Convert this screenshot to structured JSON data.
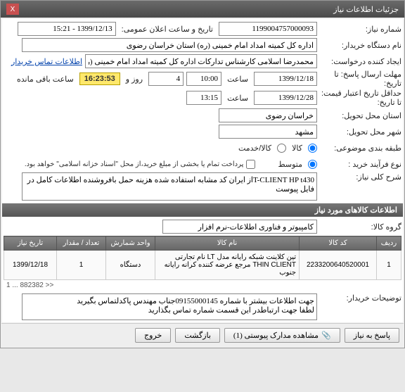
{
  "window": {
    "title": "جزئیات اطلاعات نیاز",
    "close": "X"
  },
  "section1": {
    "header": "",
    "reqno_lbl": "شماره نیاز:",
    "reqno": "1199004757000093",
    "pubdate_lbl": "تاریخ و ساعت اعلان عمومی:",
    "pubdate": "1399/12/13 - 15:21",
    "buyer_lbl": "نام دستگاه خریدار:",
    "buyer": "اداره کل کمیته امداد امام خمینی (ره) استان خراسان رضوی",
    "creator_lbl": "ایجاد کننده درخواست:",
    "creator": "محمدرضا اسلامی کارشناس تدارکات اداره کل کمیته امداد امام خمینی (ره) است",
    "contact_link": "اطلاعات تماس خریدار",
    "deadline_resp_lbl": "مهلت ارسال پاسخ: تا تاریخ:",
    "deadline_date": "1399/12/18",
    "time_lbl": "ساعت",
    "deadline_time": "10:00",
    "days_remain": "4",
    "days_lbl": "روز و",
    "timer": "16:23:53",
    "remain_lbl": "ساعت باقی مانده",
    "price_valid_lbl": "حداقل تاریخ اعتبار قیمت: تا تاریخ:",
    "price_valid_date": "1399/12/28",
    "price_valid_time": "13:15",
    "deliv_prov_lbl": "استان محل تحویل:",
    "deliv_prov": "خراسان رضوی",
    "deliv_city_lbl": "شهر محل تحویل:",
    "deliv_city": "مشهد",
    "group_lbl": "طبقه بندی موضوعی:",
    "group_opt1": "کالا",
    "group_opt2": "کالا/خدمت",
    "process_lbl": "نوع فرآیند خرید :",
    "process_opt1": "متوسط",
    "process_note": "پرداخت تمام یا بخشی از مبلغ خرید،از محل \"اسناد خزانه اسلامی\" خواهد بود.",
    "desc_lbl": "شرح کلی نیاز:",
    "desc": "T-CLIENT HP t430از ایران کد مشابه استفاده شده هزینه حمل بافروشنده اطلاعات کامل در فایل پیوست"
  },
  "section2": {
    "header": "اطلاعات کالاهای مورد نیاز",
    "group_lbl": "گروه کالا:",
    "group": "کامپیوتر و فناوری اطلاعات-نرم افزار",
    "cols": {
      "row": "ردیف",
      "code": "کد کالا",
      "name": "نام کالا",
      "unit": "واحد شمارش",
      "qty": "تعداد / مقدار",
      "date": "تاریخ نیاز"
    },
    "items": [
      {
        "row": "1",
        "code": "2233200640520001",
        "name": "تین کلاینت شبکه رایانه مدل LT نام تجارتی THIN CLIENT مرجع عرضه کننده کرانه رایانه جنوب",
        "unit": "دستگاه",
        "qty": "1",
        "date": "1399/12/18"
      }
    ],
    "pager": "1 ... 882382 >>",
    "buyer_notes_lbl": "توضیحات خریدار:",
    "buyer_notes": "جهت اطلاعات بیشتر با شماره 09155000145جناب مهندس پاکدلتماس بگیرید\nلطفا جهت ارتباطدر این قسمت شماره تماس بگذارید"
  },
  "footer": {
    "reply": "پاسخ به نیاز",
    "attach": "مشاهده مدارک پیوستی (1)",
    "back": "بازگشت",
    "exit": "خروج"
  }
}
